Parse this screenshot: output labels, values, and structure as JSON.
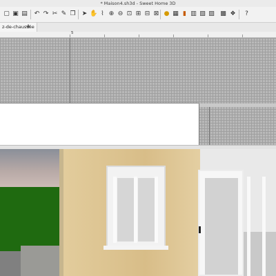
{
  "window": {
    "title": "* Maison4.sh3d - Sweet Home 3D"
  },
  "toolbar": {
    "icons": [
      "new-icon",
      "open-icon",
      "save-icon",
      "undo-icon",
      "redo-icon",
      "cut-icon",
      "copy-icon",
      "paste-icon",
      "add-furniture-icon",
      "select-icon",
      "pan-icon",
      "create-walls-icon",
      "create-rooms-icon",
      "create-polylines-icon",
      "create-dimensions-icon",
      "add-text-icon",
      "zoom-in-icon",
      "zoom-out-icon",
      "increase-text-icon",
      "decrease-text-icon",
      "create-photo-icon",
      "create-video-icon",
      "preferences-icon",
      "help-icon"
    ]
  },
  "plan": {
    "level_tab": "z-de-chaussée",
    "add_level": "+",
    "ruler_label": "5"
  }
}
